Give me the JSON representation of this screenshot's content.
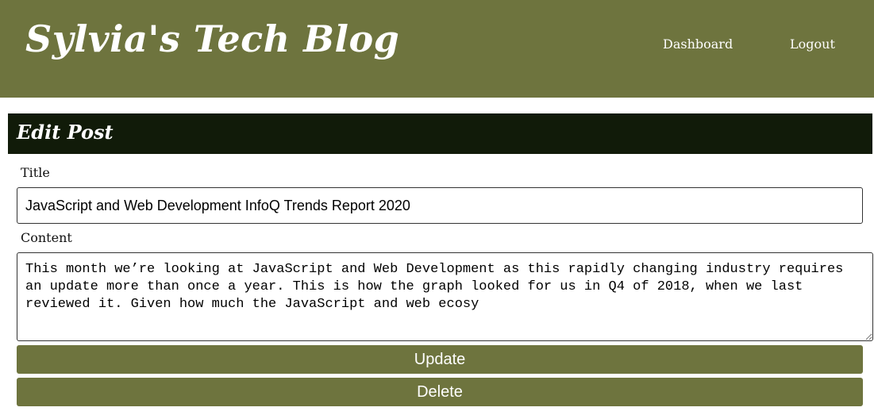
{
  "header": {
    "site_title": "Sylvia's Tech Blog",
    "nav": {
      "dashboard": "Dashboard",
      "logout": "Logout"
    }
  },
  "edit_post": {
    "heading": "Edit Post",
    "title_label": "Title",
    "title_value": "JavaScript and Web Development InfoQ Trends Report 2020",
    "content_label": "Content",
    "content_value": "This month we’re looking at JavaScript and Web Development as this rapidly changing industry requires an update more than once a year. This is how the graph looked for us in Q4 of 2018, when we last reviewed it. Given how much the JavaScript and web ecosy",
    "update_label": "Update",
    "delete_label": "Delete"
  },
  "colors": {
    "header_bg": "#6e743e",
    "edit_bar_bg": "#111b09",
    "button_bg": "#6e743e",
    "text_light": "#ffffff"
  }
}
